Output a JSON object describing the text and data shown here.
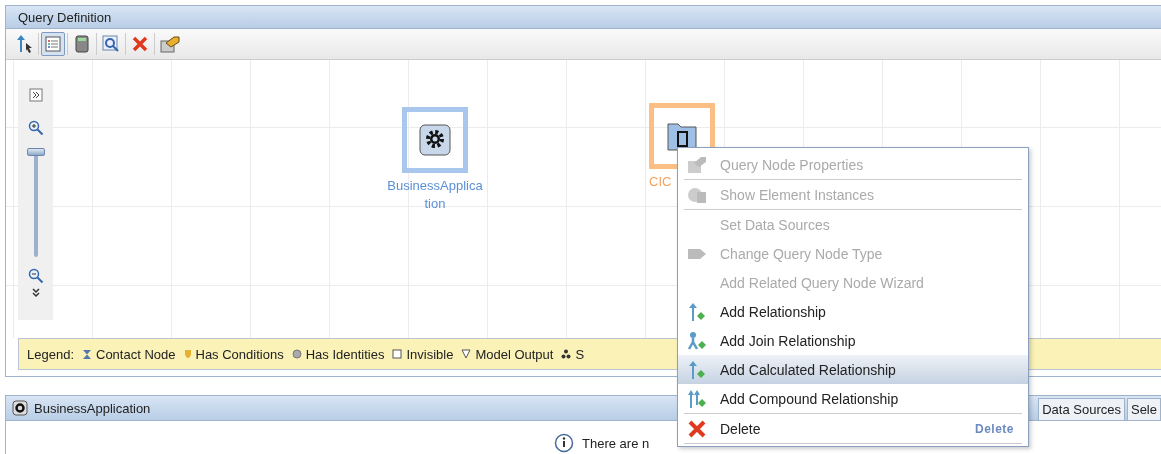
{
  "query_panel": {
    "title": "Query Definition",
    "toolbar": [
      {
        "kind": "relation",
        "selected": false
      },
      {
        "kind": "list",
        "selected": true
      },
      {
        "kind": "calc",
        "selected": false
      },
      {
        "kind": "search",
        "selected": false
      },
      {
        "kind": "delete",
        "selected": false
      },
      {
        "kind": "properties",
        "selected": false
      }
    ],
    "zoom_slider": {
      "level": 1
    },
    "nodes": [
      {
        "kind": "gear",
        "label_lines": [
          "BusinessApplica",
          "tion"
        ],
        "selected": false
      },
      {
        "kind": "folder",
        "label_lines": [
          "CIC"
        ],
        "selected": true
      }
    ],
    "legend": {
      "title": "Legend:",
      "items": [
        {
          "kind": "contact",
          "label": "Contact Node"
        },
        {
          "kind": "conditions",
          "label": "Has Conditions"
        },
        {
          "kind": "identities",
          "label": "Has Identities"
        },
        {
          "kind": "invisible",
          "label": "Invisible"
        },
        {
          "kind": "output",
          "label": "Model Output"
        },
        {
          "kind": "s",
          "label": "S"
        }
      ]
    }
  },
  "details_panel": {
    "title": "BusinessApplication",
    "tabs": [
      {
        "label": "Data Sources",
        "selected": false
      },
      {
        "label": "Sele",
        "selected": false
      }
    ],
    "message": "There are n"
  },
  "context_menu": {
    "items": [
      {
        "kind": "properties",
        "label": "Query Node Properties",
        "disabled": true,
        "selected": false,
        "separator_after": true
      },
      {
        "kind": "instances",
        "label": "Show Element Instances",
        "disabled": true,
        "selected": false,
        "separator_after": true
      },
      {
        "kind": "none",
        "label": "Set Data Sources",
        "disabled": true,
        "selected": false,
        "separator_after": false
      },
      {
        "kind": "type",
        "label": "Change Query Node Type",
        "disabled": true,
        "selected": false,
        "separator_after": false
      },
      {
        "kind": "none",
        "label": "Add Related Query Node Wizard",
        "disabled": true,
        "selected": false,
        "separator_after": false
      },
      {
        "kind": "relationship",
        "label": "Add Relationship",
        "disabled": false,
        "selected": false,
        "separator_after": false
      },
      {
        "kind": "join",
        "label": "Add Join Relationship",
        "disabled": false,
        "selected": false,
        "separator_after": false
      },
      {
        "kind": "relationship",
        "label": "Add Calculated Relationship",
        "disabled": false,
        "selected": true,
        "separator_after": false
      },
      {
        "kind": "compound",
        "label": "Add Compound Relationship",
        "disabled": false,
        "selected": false,
        "separator_after": true
      },
      {
        "kind": "delete",
        "label": "Delete",
        "shortcut": "Delete",
        "disabled": false,
        "selected": false,
        "separator_after": true
      }
    ]
  }
}
